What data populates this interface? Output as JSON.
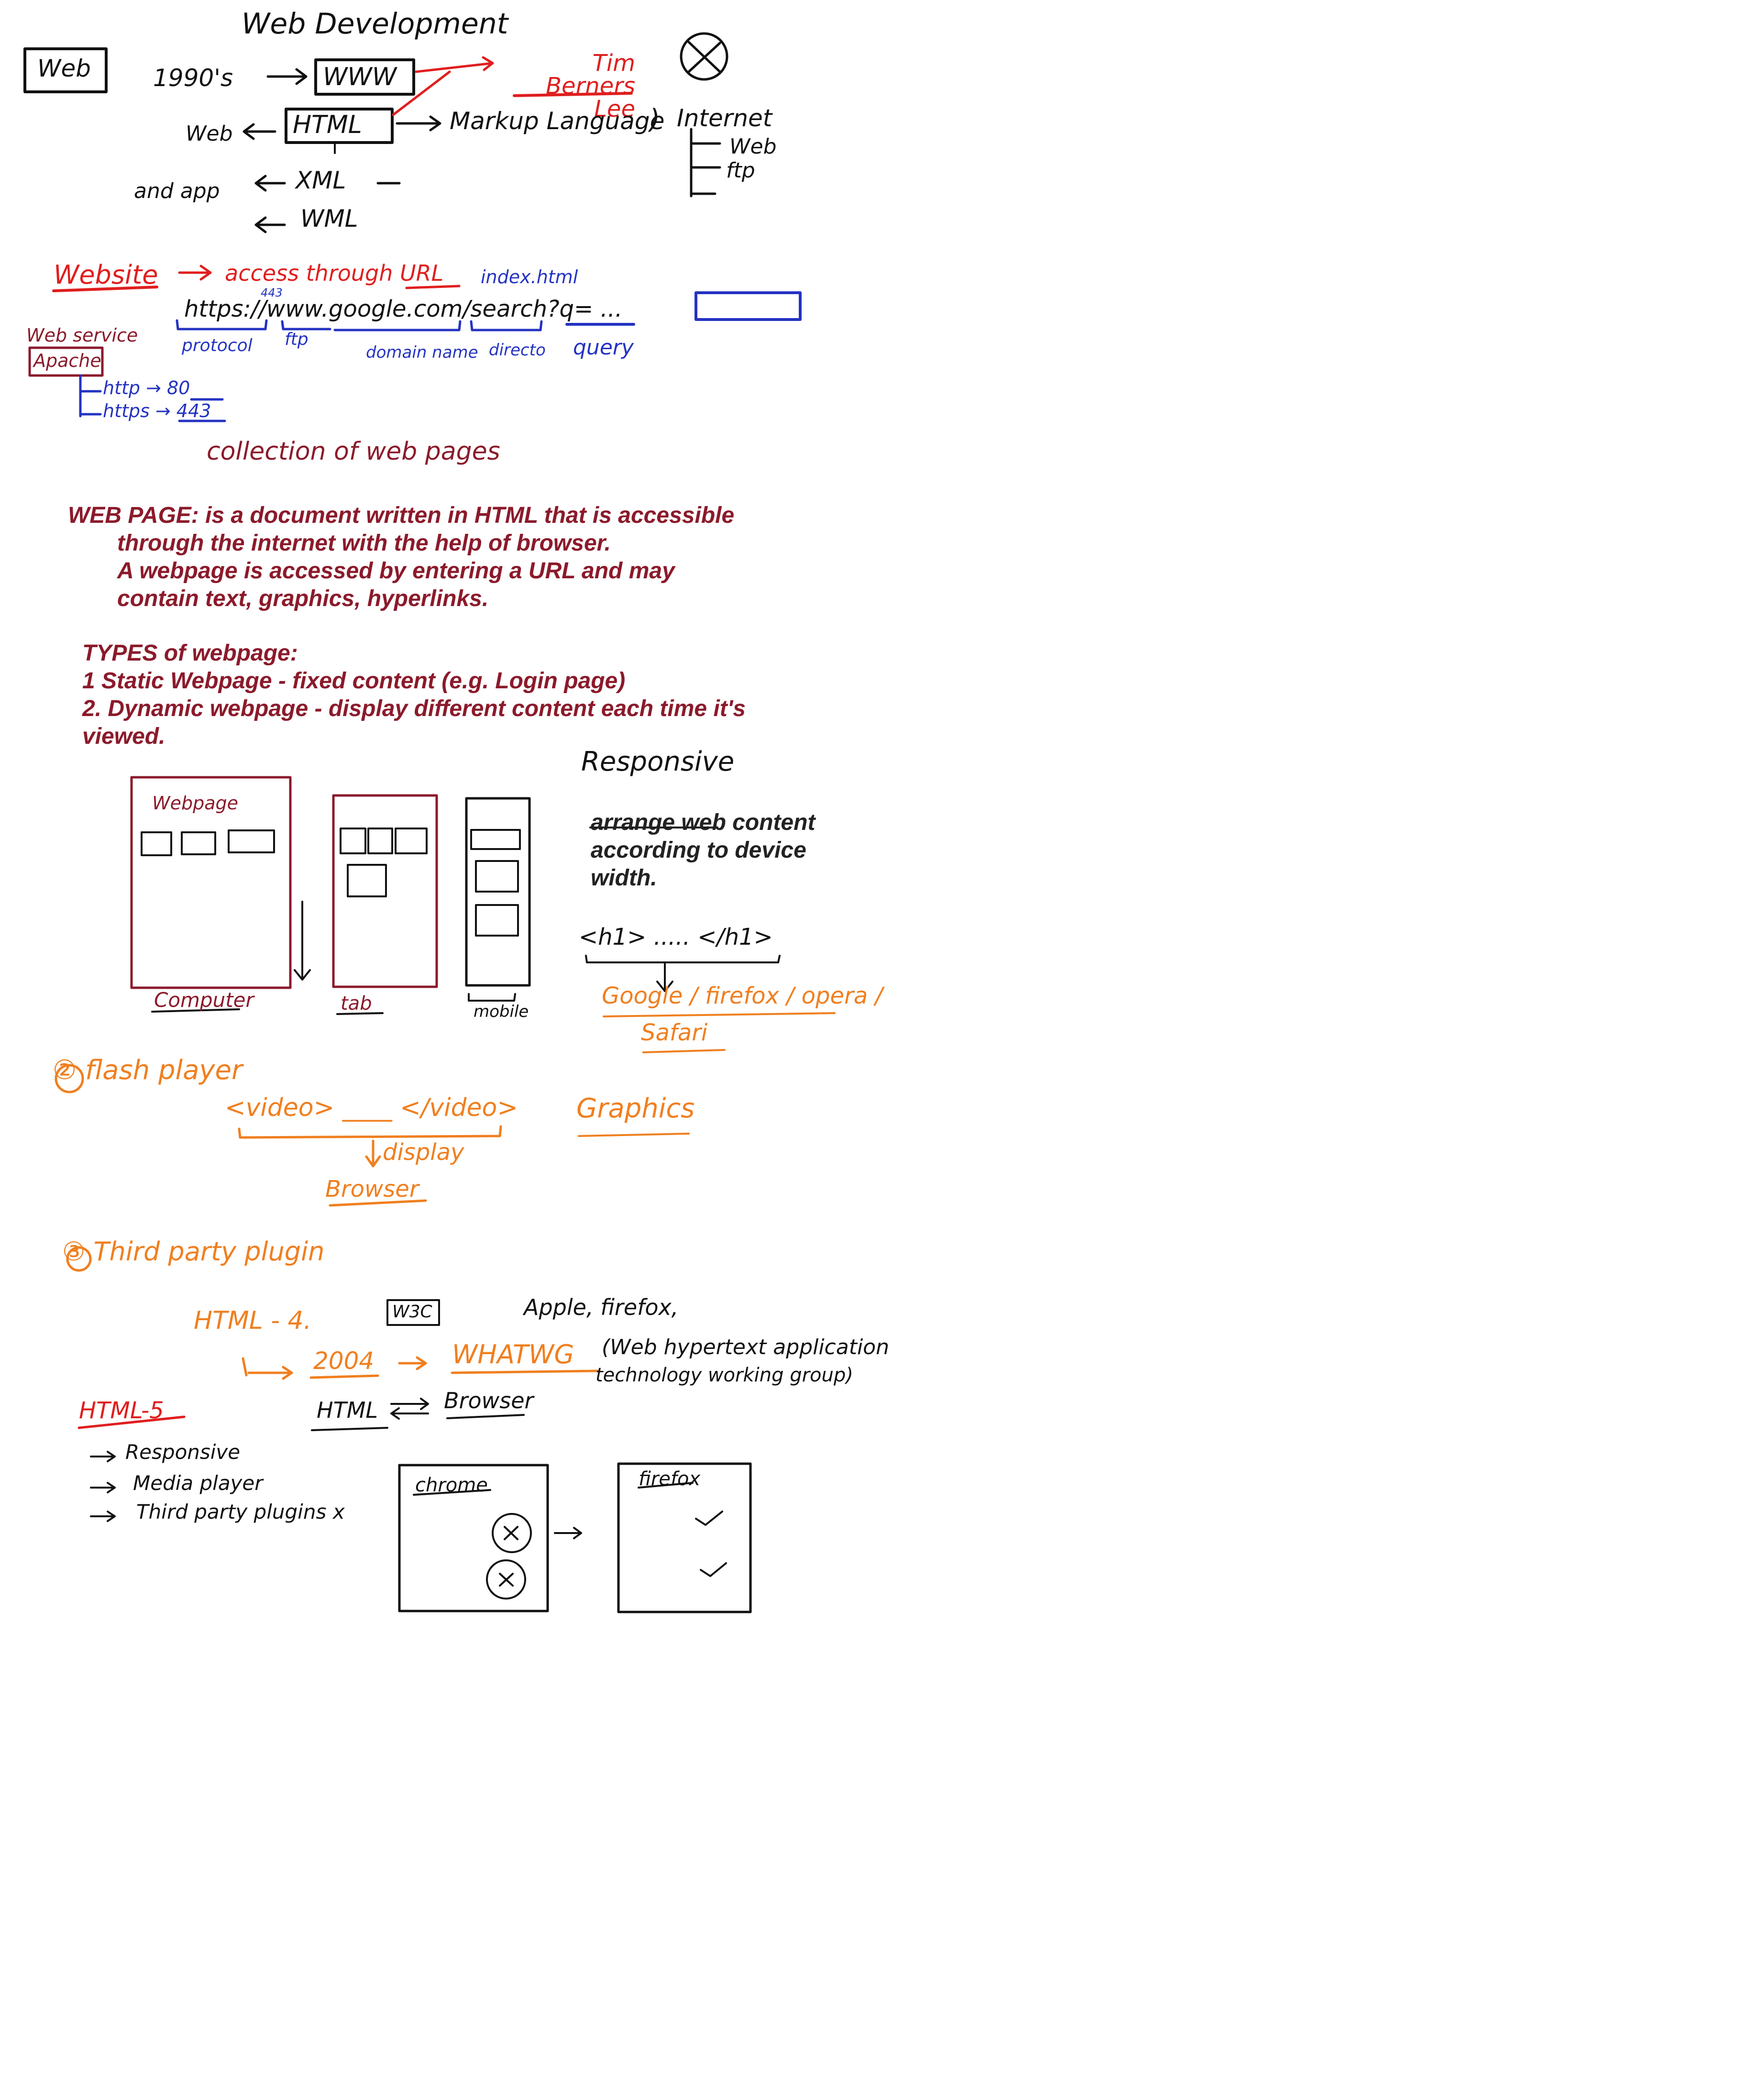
{
  "colors": {
    "ink_black": "#111111",
    "ink_red": "#e01e1e",
    "ink_maroon": "#8b1a2b",
    "ink_blue": "#2433c2",
    "ink_orange": "#f07f1f"
  },
  "history": {
    "title": "Web Development",
    "web_box": "Web",
    "year": "1990's",
    "www": "WWW",
    "inventor": "Tim Berners Lee",
    "web_label": "Web",
    "html": "HTML",
    "markup": "Markup Language",
    "and_app": "and app",
    "xml": "XML",
    "wml": "WML",
    "internet": "Internet",
    "internet_web": "Web",
    "internet_ftp": "ftp"
  },
  "website": {
    "label": "Website",
    "access": "access through URL",
    "index": "index.html",
    "port_note": "443",
    "url": "https://www.google.com/search?q= ...",
    "protocol": "protocol",
    "ftp": "ftp",
    "domain": "domain name",
    "directory": "directo",
    "query": "query",
    "web_service": "Web service",
    "apache": "Apache",
    "http_port": "http → 80",
    "https_port": "https → 443",
    "collection": "collection of web pages"
  },
  "definition": {
    "line1": "WEB PAGE: is a document written in HTML that is accessible",
    "line2": "through the internet with the help of browser.",
    "line3": "A webpage is accessed  by entering a URL and may",
    "line4": "contain text, graphics, hyperlinks."
  },
  "types": {
    "heading": "TYPES of webpage:",
    "item1": "1 Static Webpage - fixed content (e.g. Login page)",
    "item2": "2. Dynamic webpage - display different content each time it's",
    "item2b": "viewed."
  },
  "responsive": {
    "title": "Responsive",
    "desc1": "arrange web content",
    "desc2": "according to device",
    "desc3": "width.",
    "webpage": "Webpage",
    "computer": "Computer",
    "tab": "tab",
    "mobile": "mobile",
    "h1_tag": "<h1> ..... </h1>",
    "browsers": "Google / firefox / opera /",
    "safari": "Safari"
  },
  "flash": {
    "label": "② flash player",
    "video_tag": "<video> ____ </video>",
    "display": "display",
    "browser": "Browser",
    "graphics": "Graphics"
  },
  "plugin": {
    "label": "③ Third party plugin",
    "html4": "HTML - 4.",
    "w3c": "W3C",
    "apple": "Apple, firefox,",
    "year": "2004",
    "whatwg": "WHATWG",
    "whatwg_full1": "(Web hypertext application",
    "whatwg_full2": "technology working group)",
    "html_browser_l": "HTML",
    "html_browser_r": "Browser",
    "html5": "HTML-5",
    "html5_item1": "Responsive",
    "html5_item2": "Media player",
    "html5_item3": "Third party plugins  x",
    "chrome": "chrome",
    "firefox": "firefox"
  }
}
